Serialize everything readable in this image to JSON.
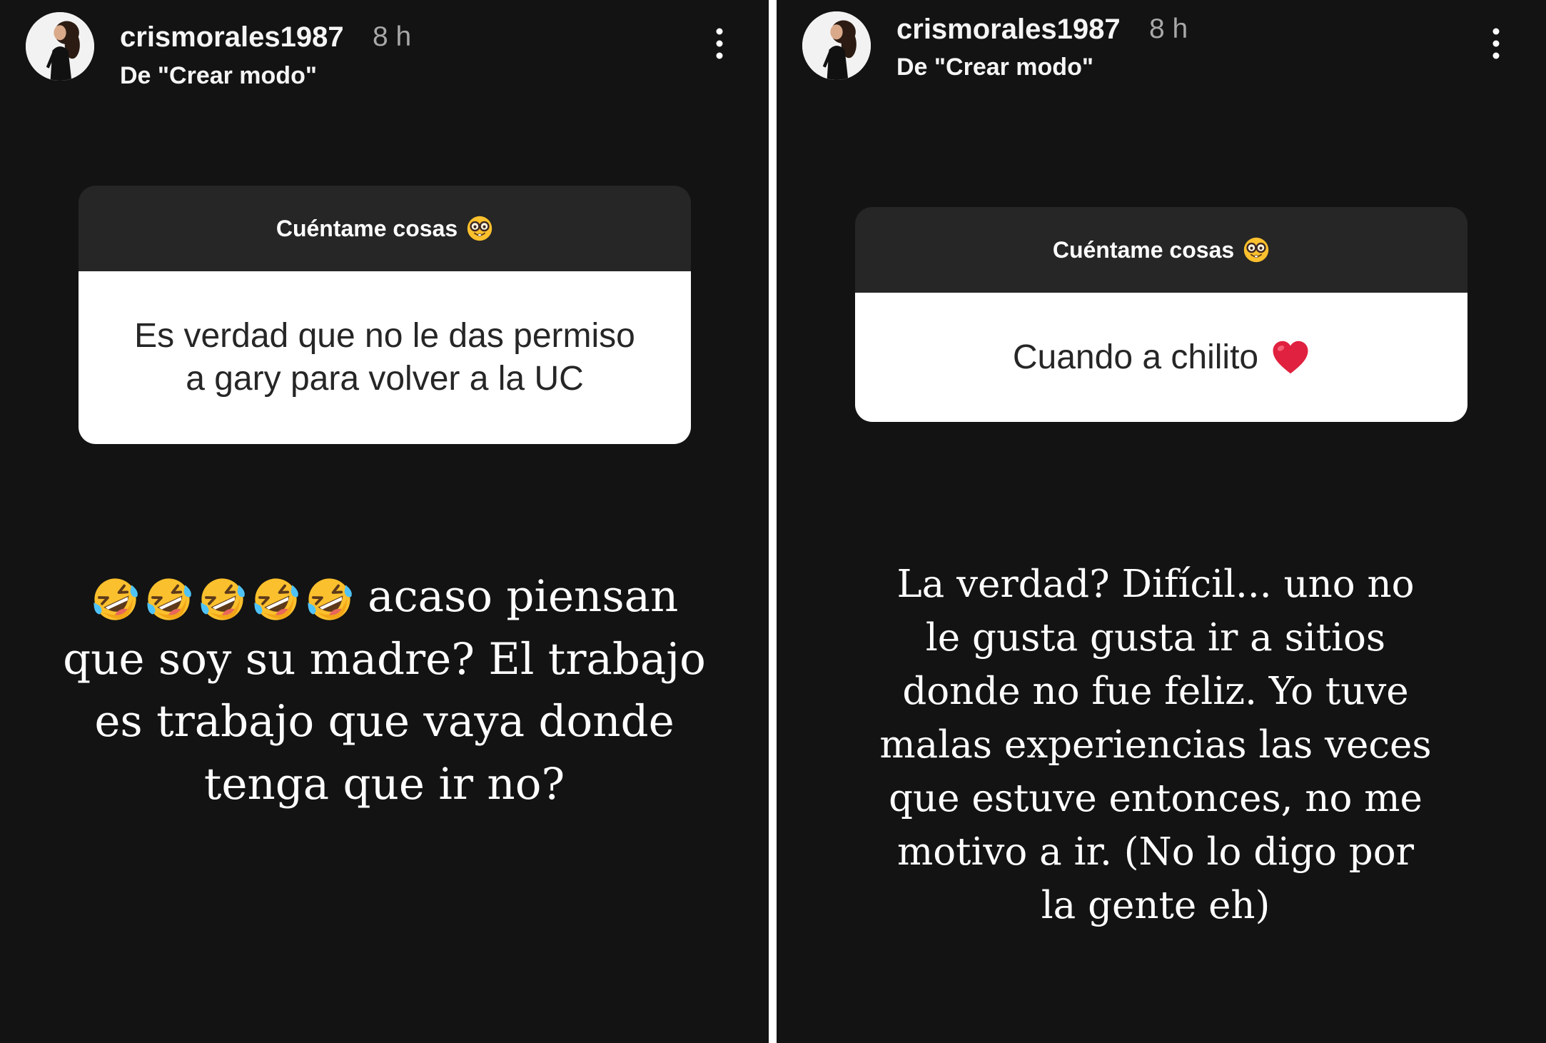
{
  "colors": {
    "background": "#131313",
    "divider": "#ffffff",
    "card_header": "#262626",
    "card_body": "#ffffff",
    "muted_text": "#a8a8a8"
  },
  "panels": [
    {
      "header": {
        "avatar_icon": "profile-photo-avatar",
        "username": "crismorales1987",
        "time": "8 h",
        "source": "De \"Crear modo\"",
        "menu_icon": "more-vertical-icon"
      },
      "question": {
        "title": "Cuéntame cosas",
        "title_icon": "nerd-face-emoji-icon",
        "lines": [
          "Es verdad que no le das permiso",
          "a gary para volver a la UC"
        ]
      },
      "answer": {
        "lead_icons": [
          "rolling-on-floor-laughing-emoji-icon",
          "rolling-on-floor-laughing-emoji-icon",
          "rolling-on-floor-laughing-emoji-icon",
          "rolling-on-floor-laughing-emoji-icon",
          "rolling-on-floor-laughing-emoji-icon"
        ],
        "lines": [
          "acaso piensan",
          "que soy su madre? El trabajo",
          "es trabajo que vaya donde",
          "tenga que ir no?"
        ]
      }
    },
    {
      "header": {
        "avatar_icon": "profile-photo-avatar",
        "username": "crismorales1987",
        "time": "8 h",
        "source": "De \"Crear modo\"",
        "menu_icon": "more-vertical-icon"
      },
      "question": {
        "title": "Cuéntame cosas",
        "title_icon": "nerd-face-emoji-icon",
        "lines": [
          "Cuando a chilito"
        ],
        "trailing_icon": "red-heart-emoji-icon"
      },
      "answer": {
        "lines": [
          "La verdad? Difícil... uno no",
          "le gusta gusta ir a sitios",
          "donde no fue feliz. Yo tuve",
          "malas experiencias las veces",
          "que estuve entonces, no me",
          "motivo a ir. (No lo digo por",
          "la gente eh)"
        ]
      }
    }
  ]
}
